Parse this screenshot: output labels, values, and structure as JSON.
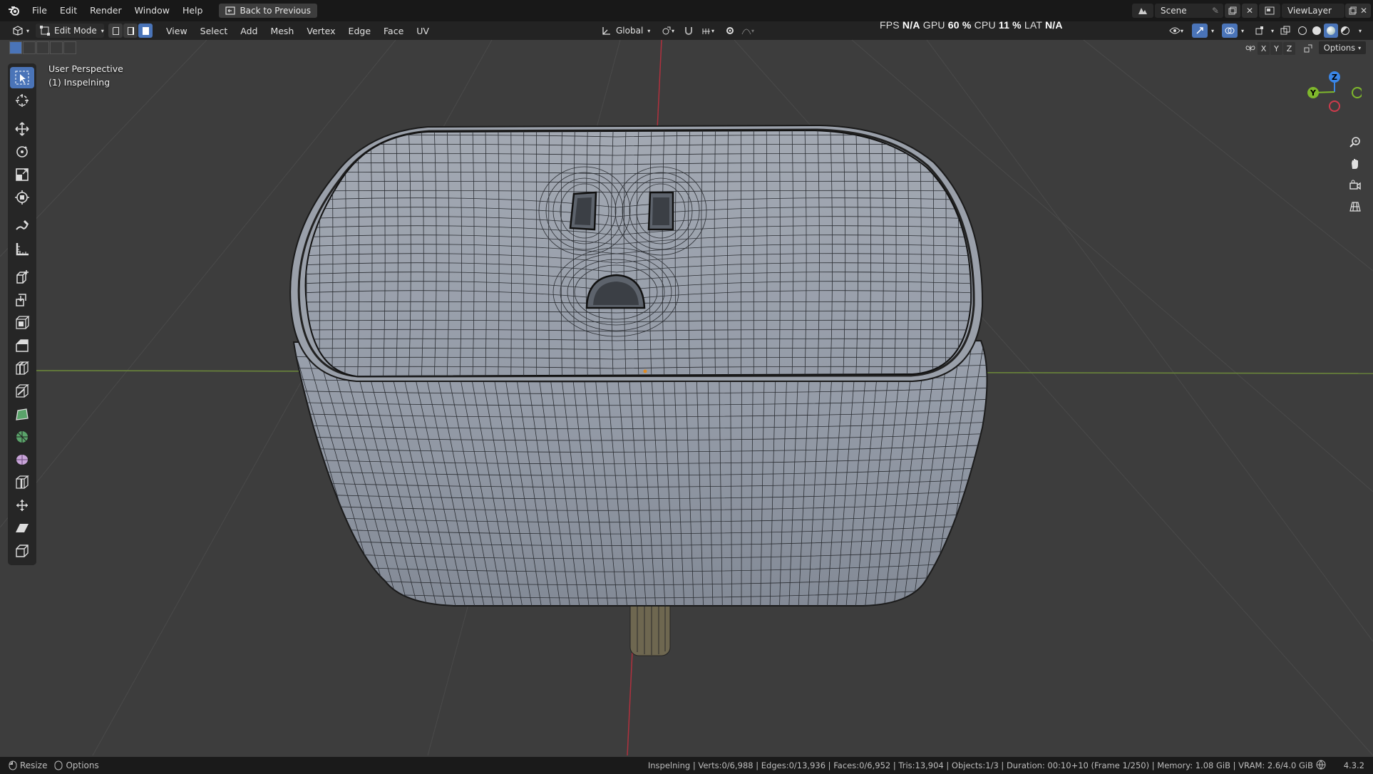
{
  "app": {
    "menus": [
      "File",
      "Edit",
      "Render",
      "Window",
      "Help"
    ],
    "back_button": "Back to Previous",
    "scene": "Scene",
    "view_layer": "ViewLayer"
  },
  "header": {
    "mode": "Edit Mode",
    "menus": [
      "View",
      "Select",
      "Add",
      "Mesh",
      "Vertex",
      "Edge",
      "Face",
      "UV"
    ],
    "transform_orientation": "Global",
    "options_label": "Options",
    "axis_x": "X",
    "axis_y": "Y",
    "axis_z": "Z"
  },
  "perf": {
    "fps_label": "FPS",
    "fps_value": "N/A",
    "gpu_label": "GPU",
    "gpu_value": "60 %",
    "cpu_label": "CPU",
    "cpu_value": "11 %",
    "lat_label": "LAT",
    "lat_value": "N/A"
  },
  "viewport": {
    "view_name": "User Perspective",
    "object_name": "(1) Inspelning",
    "gizmo": {
      "x_label": "X",
      "y_label": "Y",
      "z_label": "Z"
    }
  },
  "tools": [
    "select-box",
    "cursor",
    "move",
    "rotate",
    "scale",
    "transform",
    "annotate",
    "measure",
    "add-cube",
    "extrude-region",
    "inset-faces",
    "bevel",
    "loop-cut",
    "knife",
    "poly-build",
    "spin",
    "smooth",
    "edge-slide",
    "shrink-fatten",
    "shear",
    "rip-region"
  ],
  "statusbar": {
    "left_1": "Resize",
    "left_2": "Options",
    "info": "Inspelning | Verts:0/6,988 | Edges:0/13,936 | Faces:0/6,952 | Tris:13,904 | Objects:1/3 | Duration: 00:10+10 (Frame 1/250) | Memory: 1.08 GiB | VRAM: 2.6/4.0 GiB",
    "version": "4.3.2"
  },
  "colors": {
    "accent": "#4a74b8",
    "viewport_bg": "#3d3d3d",
    "x_axis": "#cf3b4c",
    "y_axis": "#7fb82c",
    "z_axis": "#3a86e8"
  }
}
